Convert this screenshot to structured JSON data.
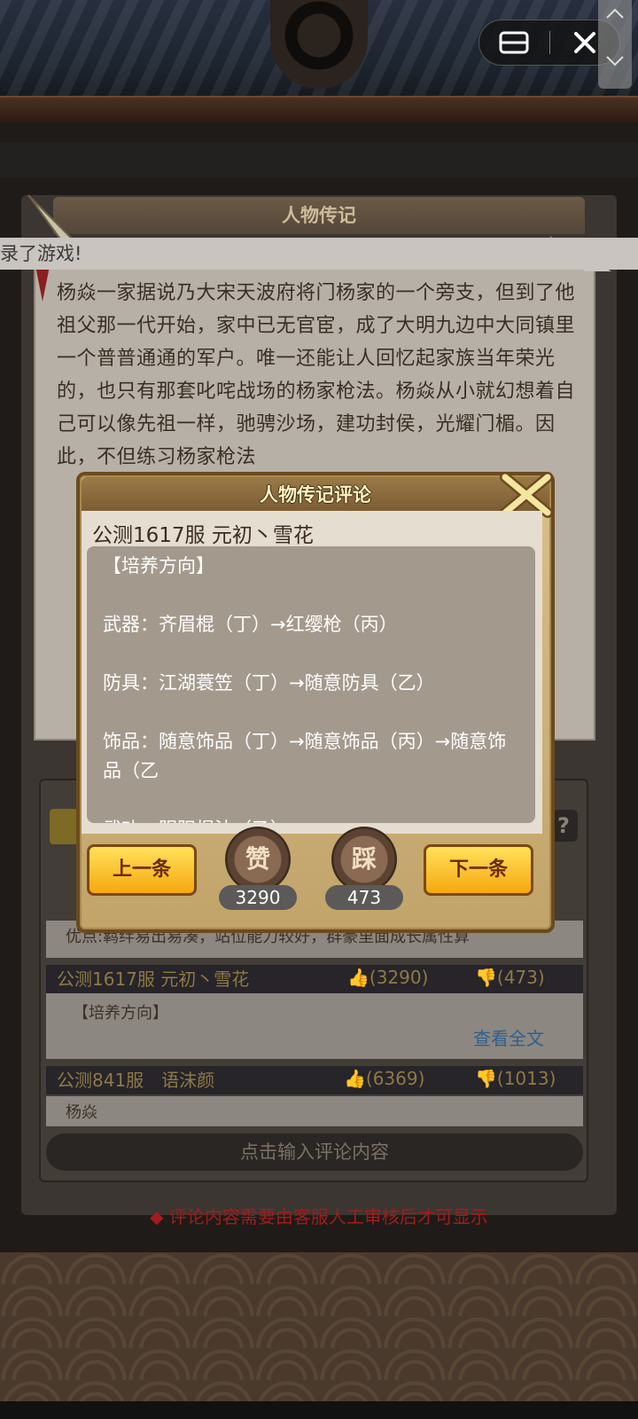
{
  "window": {
    "mini_program_menu_icon": "menu-icon",
    "close_icon": "close-icon"
  },
  "banner": {
    "text": "录了游戏!"
  },
  "biography": {
    "title": "人物传记",
    "text": "杨焱一家据说乃大宋天波府将门杨家的一个旁支，但到了他祖父那一代开始，家中已无官宦，成了大明九边中大同镇里一个普普通通的军户。唯一还能让人回忆起家族当年荣光的，也只有那套叱咤战场的杨家枪法。杨焱从小就幻想着自己可以像先祖一样，驰骋沙场，建功封侯，光耀门楣。因此，不但练习杨家枪法"
  },
  "comments": {
    "items": [
      {
        "body_line": "优点:羁绊易出易凑，站位能力较好，群豪里面成长属性算"
      },
      {
        "author": "公测1617服 元初丶雪花",
        "likes": "(3290)",
        "dislikes": "(473)",
        "preview": "【培养方向】",
        "view_all": "查看全文"
      },
      {
        "author": "公测841服　语沫颜",
        "likes": "(6369)",
        "dislikes": "(1013)",
        "preview": "杨焱"
      }
    ],
    "input_placeholder": "点击输入评论内容",
    "notice": "◆ 评论内容需要由客服人工审核后才可显示"
  },
  "dialog": {
    "title": "人物传记评论",
    "author": "公测1617服 元初丶雪花",
    "content": "【培养方向】\n\n武器：齐眉棍（丁）→红缨枪（丙）\n\n防具：江湖蓑笠（丁）→随意防具（乙）\n\n饰品：随意饰品（丁）→随意饰品（丙）→随意饰品（乙\n\n武功：阴阳棍法（乙）",
    "prev_label": "上一条",
    "next_label": "下一条",
    "like_label": "赞",
    "dislike_label": "踩",
    "like_count": "3290",
    "dislike_count": "473"
  },
  "colors": {
    "gold_button": "#f7a710",
    "dialog_bg": "#c1a46a",
    "notice_red": "#a01d1d",
    "view_all_blue": "#2f5f8f"
  }
}
